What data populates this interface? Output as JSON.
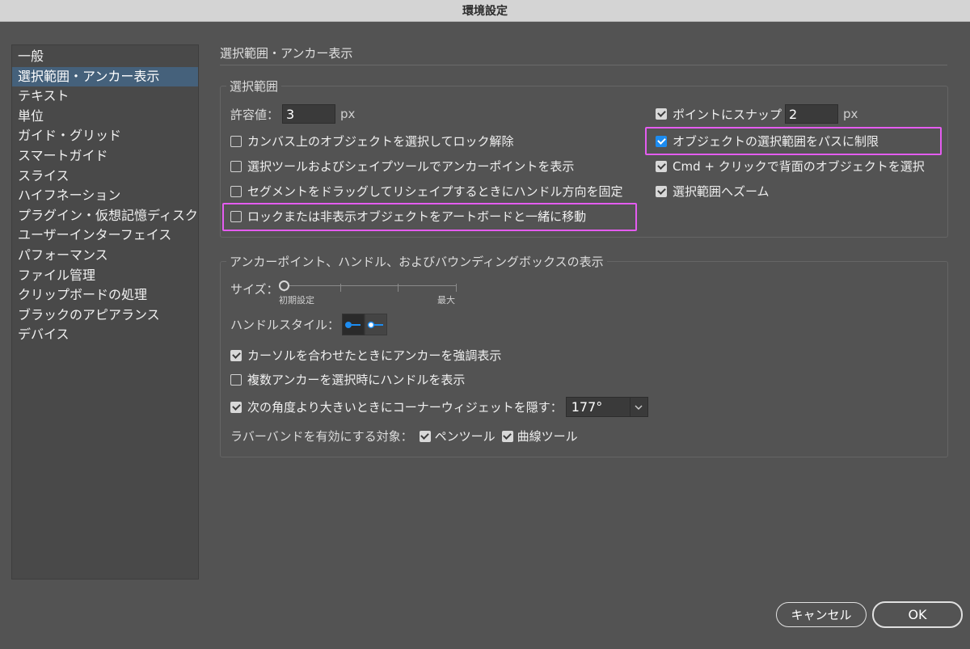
{
  "window": {
    "title": "環境設定"
  },
  "sidebar": {
    "items": [
      {
        "label": "一般"
      },
      {
        "label": "選択範囲・アンカー表示"
      },
      {
        "label": "テキスト"
      },
      {
        "label": "単位"
      },
      {
        "label": "ガイド・グリッド"
      },
      {
        "label": "スマートガイド"
      },
      {
        "label": "スライス"
      },
      {
        "label": "ハイフネーション"
      },
      {
        "label": "プラグイン・仮想記憶ディスク"
      },
      {
        "label": "ユーザーインターフェイス"
      },
      {
        "label": "パフォーマンス"
      },
      {
        "label": "ファイル管理"
      },
      {
        "label": "クリップボードの処理"
      },
      {
        "label": "ブラックのアピアランス"
      },
      {
        "label": "デバイス"
      }
    ],
    "selected_index": 1
  },
  "page": {
    "title": "選択範囲・アンカー表示"
  },
  "selection": {
    "group_title": "選択範囲",
    "tolerance": {
      "label": "許容値：",
      "value": "3",
      "unit": "px"
    },
    "snap_to_point": {
      "label": "ポイントにスナップ",
      "checked": true,
      "value": "2",
      "unit": "px"
    },
    "left": [
      {
        "label": "カンバス上のオブジェクトを選択してロック解除",
        "checked": false
      },
      {
        "label": "選択ツールおよびシェイプツールでアンカーポイントを表示",
        "checked": false
      },
      {
        "label": "セグメントをドラッグしてリシェイプするときにハンドル方向を固定",
        "checked": false
      },
      {
        "label": "ロックまたは非表示オブジェクトをアートボードと一緒に移動",
        "checked": false
      }
    ],
    "right": [
      {
        "label": "オブジェクトの選択範囲をパスに制限",
        "checked": true
      },
      {
        "label": "Cmd + クリックで背面のオブジェクトを選択",
        "checked": true
      },
      {
        "label": "選択範囲へズーム",
        "checked": true
      }
    ]
  },
  "anchor": {
    "group_title": "アンカーポイント、ハンドル、およびバウンディングボックスの表示",
    "size": {
      "label": "サイズ：",
      "min_label": "初期設定",
      "max_label": "最大",
      "value_fraction": 0
    },
    "handle_style": {
      "label": "ハンドルスタイル：",
      "selected": 0
    },
    "options": [
      {
        "label": "カーソルを合わせたときにアンカーを強調表示",
        "checked": true
      },
      {
        "label": "複数アンカーを選択時にハンドルを表示",
        "checked": false
      },
      {
        "label": "次の角度より大きいときにコーナーウィジェットを隠す：",
        "checked": true
      }
    ],
    "corner_angle": {
      "value": "177°"
    },
    "rubber_band": {
      "label": "ラバーバンドを有効にする対象：",
      "pen_tool": {
        "label": "ペンツール",
        "checked": true
      },
      "curvature_tool": {
        "label": "曲線ツール",
        "checked": true
      }
    }
  },
  "buttons": {
    "cancel": "キャンセル",
    "ok": "OK"
  },
  "colors": {
    "accent": "#1d8cf0",
    "highlight": "#e45cf0",
    "background": "#535353",
    "selected_row": "#45617b"
  }
}
